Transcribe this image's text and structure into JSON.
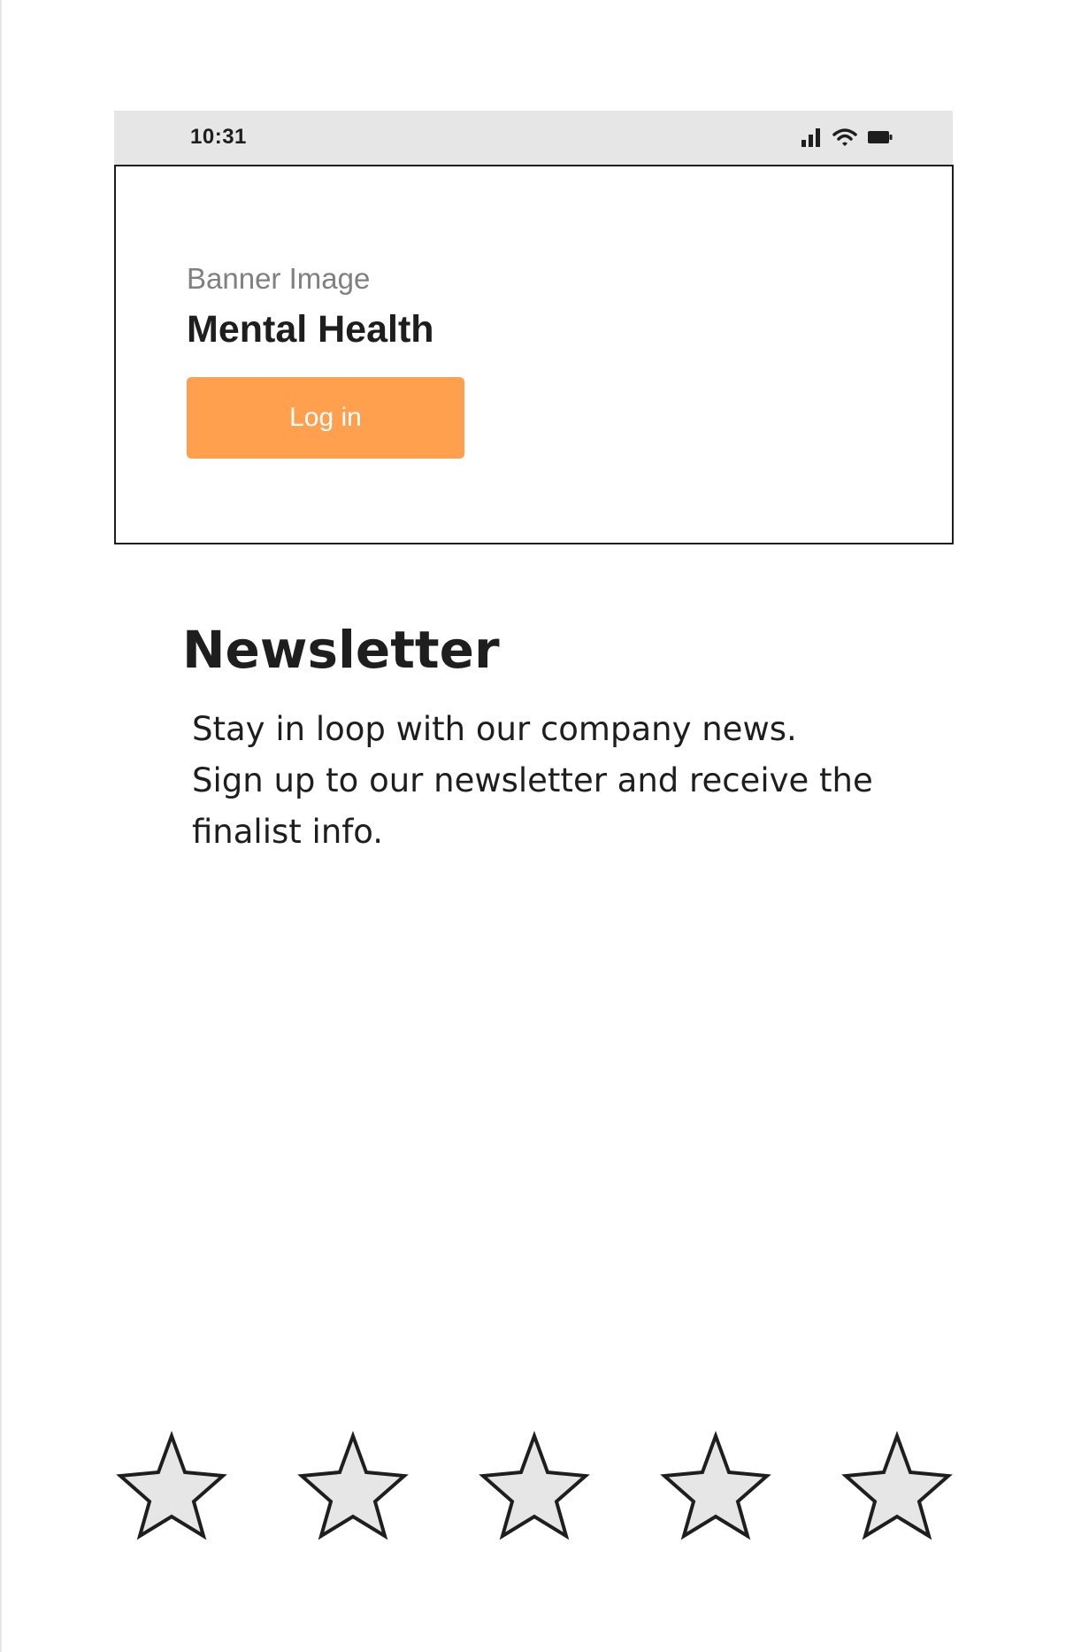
{
  "status_bar": {
    "time": "10:31",
    "icons": [
      "signal-icon",
      "wifi-icon",
      "battery-icon"
    ]
  },
  "banner": {
    "caption": "Banner Image",
    "title": "Mental Health",
    "login_label": "Log in",
    "accent_color": "#ffa04f"
  },
  "newsletter": {
    "heading": "Newsletter",
    "lines": [
      "Stay in loop with our company news.",
      "Sign up to our newsletter and receive the",
      "finalist info."
    ]
  },
  "rating": {
    "max": 5,
    "value": 0,
    "star_fill": "#e6e6e6",
    "star_stroke": "#1e1e1e"
  }
}
